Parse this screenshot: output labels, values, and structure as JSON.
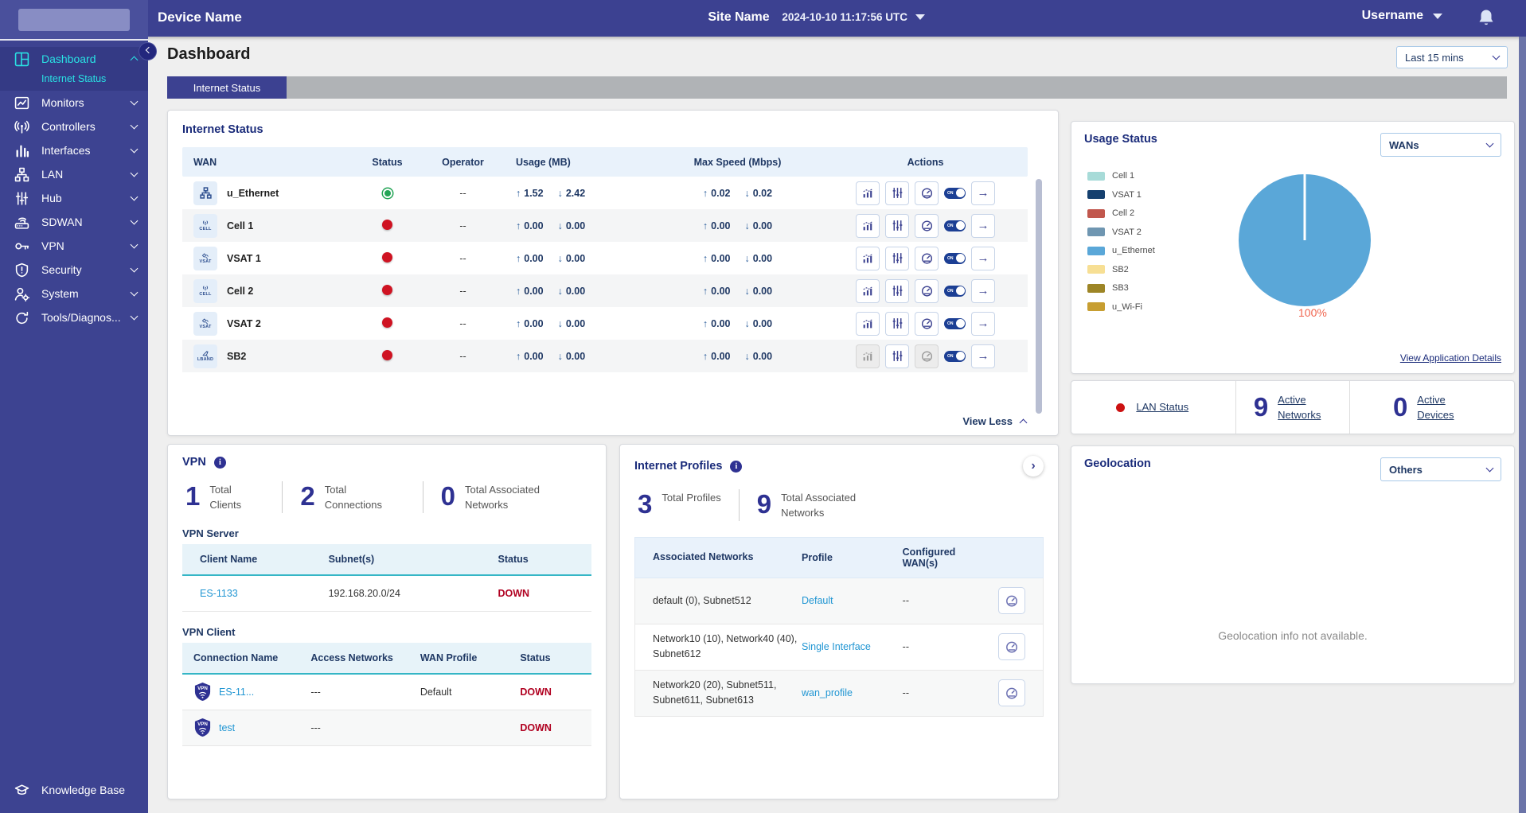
{
  "topbar": {
    "device_name": "Device Name",
    "site_name": "Site Name",
    "datetime": "2024-10-10 11:17:56 UTC",
    "username": "Username"
  },
  "sidebar": {
    "items": [
      {
        "label": "Dashboard",
        "icon": "dashboard-icon",
        "active": true
      },
      {
        "label": "Monitors",
        "icon": "monitors-icon"
      },
      {
        "label": "Controllers",
        "icon": "antenna-icon"
      },
      {
        "label": "Interfaces",
        "icon": "bar-chart-icon"
      },
      {
        "label": "LAN",
        "icon": "lan-tree-icon"
      },
      {
        "label": "Hub",
        "icon": "sliders-icon"
      },
      {
        "label": "SDWAN",
        "icon": "router-icon"
      },
      {
        "label": "VPN",
        "icon": "key-icon"
      },
      {
        "label": "Security",
        "icon": "shield-icon"
      },
      {
        "label": "System",
        "icon": "user-gear-icon"
      },
      {
        "label": "Tools/Diagnos...",
        "icon": "refresh-icon"
      }
    ],
    "active_sub_item": "Internet Status",
    "knowledge_base": "Knowledge Base"
  },
  "page": {
    "title": "Dashboard",
    "time_range": "Last 15 mins",
    "active_tab": "Internet Status"
  },
  "internet_status": {
    "title": "Internet Status",
    "columns": [
      "WAN",
      "Status",
      "Operator",
      "Usage (MB)",
      "Max Speed (Mbps)",
      "Actions"
    ],
    "toggle_on_label": "ON",
    "view_less_label": "View Less",
    "rows": [
      {
        "name": "u_Ethernet",
        "kind": "ethernet",
        "kind_label": "",
        "status": "up",
        "operator": "--",
        "usage_up": "1.52",
        "usage_down": "2.42",
        "speed_up": "0.02",
        "speed_down": "0.02"
      },
      {
        "name": "Cell 1",
        "kind": "cell",
        "kind_label": "CELL",
        "status": "down",
        "operator": "--",
        "usage_up": "0.00",
        "usage_down": "0.00",
        "speed_up": "0.00",
        "speed_down": "0.00"
      },
      {
        "name": "VSAT 1",
        "kind": "vsat",
        "kind_label": "VSAT",
        "status": "down",
        "operator": "--",
        "usage_up": "0.00",
        "usage_down": "0.00",
        "speed_up": "0.00",
        "speed_down": "0.00"
      },
      {
        "name": "Cell 2",
        "kind": "cell",
        "kind_label": "CELL",
        "status": "down",
        "operator": "--",
        "usage_up": "0.00",
        "usage_down": "0.00",
        "speed_up": "0.00",
        "speed_down": "0.00"
      },
      {
        "name": "VSAT 2",
        "kind": "vsat",
        "kind_label": "VSAT",
        "status": "down",
        "operator": "--",
        "usage_up": "0.00",
        "usage_down": "0.00",
        "speed_up": "0.00",
        "speed_down": "0.00"
      },
      {
        "name": "SB2",
        "kind": "lband",
        "kind_label": "LBAND",
        "status": "down",
        "operator": "--",
        "usage_up": "0.00",
        "usage_down": "0.00",
        "speed_up": "0.00",
        "speed_down": "0.00"
      }
    ]
  },
  "usage_status": {
    "title": "Usage Status",
    "wan_selector": "WANs",
    "percent_label": "100%",
    "details_link": "View Application Details",
    "legend": [
      {
        "label": "Cell 1",
        "color": "#a7dbd8"
      },
      {
        "label": "VSAT 1",
        "color": "#15406f"
      },
      {
        "label": "Cell 2",
        "color": "#c1574d"
      },
      {
        "label": "VSAT 2",
        "color": "#6f96b1"
      },
      {
        "label": "u_Ethernet",
        "color": "#5aa7d8"
      },
      {
        "label": "SB2",
        "color": "#f7df94"
      },
      {
        "label": "SB3",
        "color": "#9d8526"
      },
      {
        "label": "u_Wi-Fi",
        "color": "#c79e31"
      }
    ]
  },
  "chart_data": {
    "type": "pie",
    "title": "Usage Status",
    "series": [
      {
        "name": "u_Ethernet",
        "value": 100
      }
    ],
    "unit": "%",
    "annotations": [
      "100%"
    ],
    "slice_color": "#5aa7d8",
    "legend_entries": [
      "Cell 1",
      "VSAT 1",
      "Cell 2",
      "VSAT 2",
      "u_Ethernet",
      "SB2",
      "SB3",
      "u_Wi-Fi"
    ],
    "legend_position": "left"
  },
  "lan_status": {
    "link": "LAN Status",
    "status_color": "#cc1111",
    "stats": [
      {
        "value": "9",
        "label": "Active Networks"
      },
      {
        "value": "0",
        "label": "Active Devices"
      }
    ]
  },
  "vpn": {
    "title": "VPN",
    "stats": [
      {
        "value": "1",
        "label": "Total Clients"
      },
      {
        "value": "2",
        "label": "Total Connections"
      },
      {
        "value": "0",
        "label": "Total Associated Networks"
      }
    ],
    "server": {
      "heading": "VPN Server",
      "columns": [
        "Client Name",
        "Subnet(s)",
        "Status"
      ],
      "rows": [
        {
          "client": "ES-1133",
          "subnet": "192.168.20.0/24",
          "status": "DOWN"
        }
      ]
    },
    "client": {
      "heading": "VPN Client",
      "columns": [
        "Connection Name",
        "Access Networks",
        "WAN Profile",
        "Status"
      ],
      "rows": [
        {
          "name": "ES-11...",
          "access": "---",
          "profile": "Default",
          "status": "DOWN"
        },
        {
          "name": "test",
          "access": "---",
          "profile": "",
          "status": "DOWN"
        }
      ]
    }
  },
  "internet_profiles": {
    "title": "Internet Profiles",
    "stats": [
      {
        "value": "3",
        "label": "Total Profiles"
      },
      {
        "value": "9",
        "label": "Total Associated Networks"
      }
    ],
    "columns": [
      "Associated Networks",
      "Profile",
      "Configured WAN(s)"
    ],
    "rows": [
      {
        "networks": "default (0), Subnet512",
        "profile": "Default",
        "wans": "--"
      },
      {
        "networks": "Network10 (10), Network40 (40), Subnet612",
        "profile": "Single Interface",
        "wans": "--"
      },
      {
        "networks": "Network20 (20), Subnet511, Subnet611, Subnet613",
        "profile": "wan_profile",
        "wans": "--"
      }
    ]
  },
  "geolocation": {
    "title": "Geolocation",
    "selector": "Others",
    "empty_message": "Geolocation info not available."
  }
}
